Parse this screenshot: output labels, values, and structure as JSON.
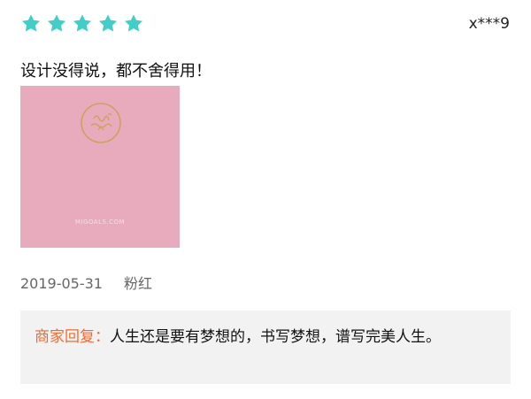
{
  "review": {
    "rating": 5,
    "rating_max": 5,
    "star_color": "#3fcfc8",
    "username": "x***9",
    "text": "设计没得说，都不舍得用！",
    "photo": {
      "background_color": "#e8abbe",
      "brand_text": "MIGOALS.COM"
    },
    "date": "2019-05-31",
    "variant": "粉红"
  },
  "merchant_reply": {
    "label": "商家回复：",
    "label_color": "#f26a2f",
    "text": "人生还是要有梦想的，书写梦想，谱写完美人生。"
  }
}
